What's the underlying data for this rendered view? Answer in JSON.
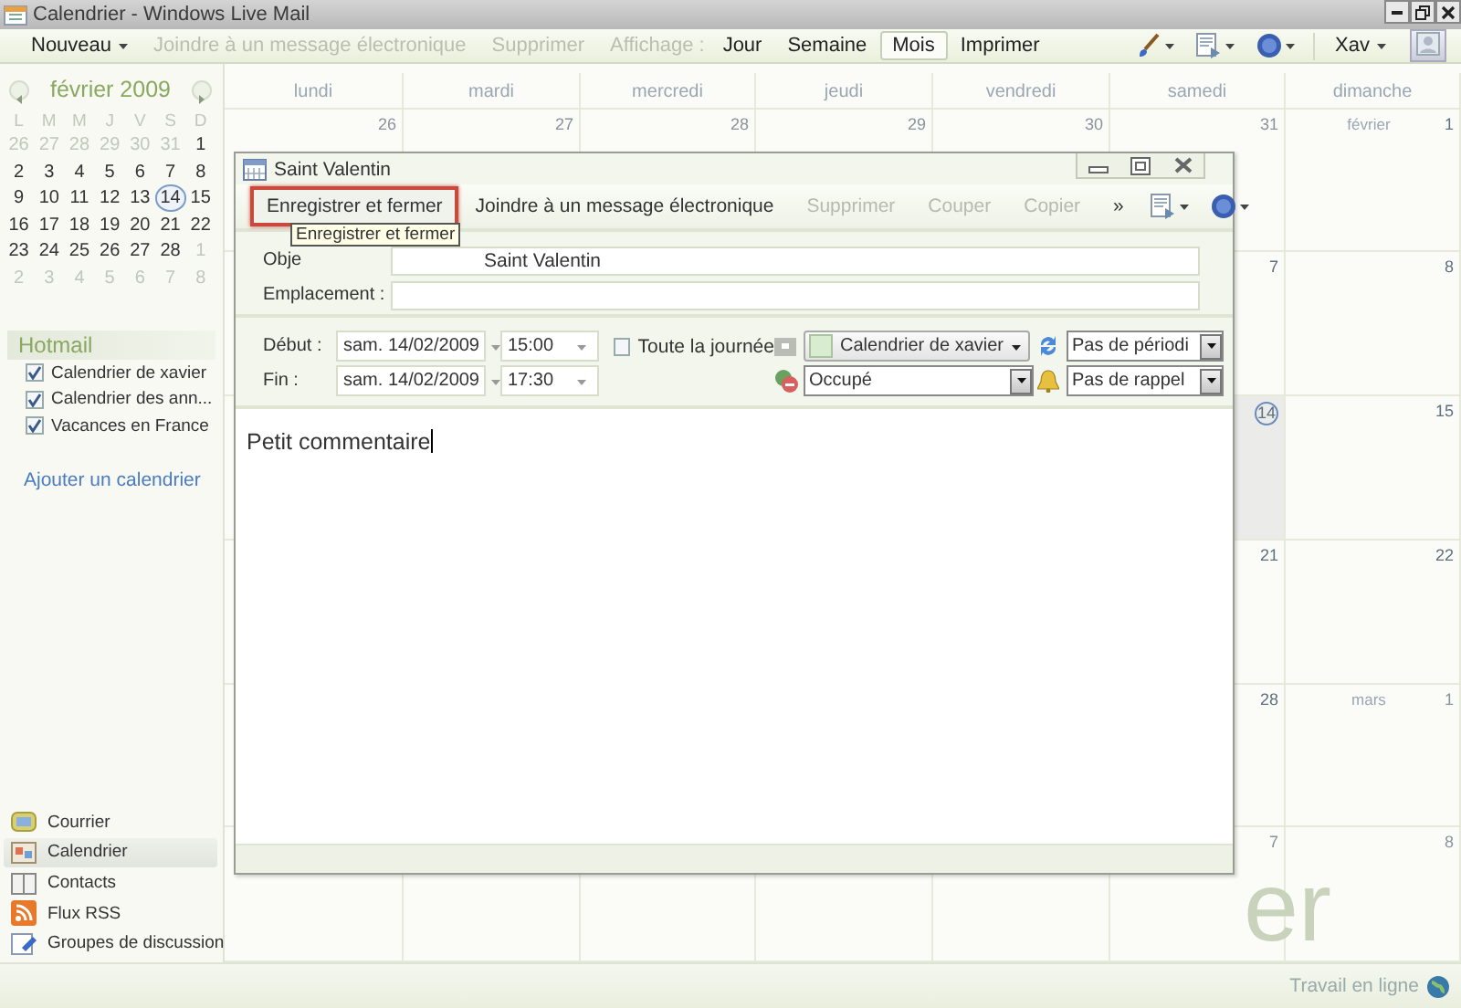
{
  "window": {
    "title": "Calendrier - Windows Live Mail"
  },
  "toolbar": [
    {
      "label": "Nouveau",
      "kind": "menu",
      "disabled": false,
      "selected": false
    },
    {
      "label": "Joindre à un message électronique",
      "kind": "button",
      "disabled": true,
      "selected": false
    },
    {
      "label": "Supprimer",
      "kind": "button",
      "disabled": true,
      "selected": false
    },
    {
      "label": "Affichage :",
      "kind": "label",
      "disabled": true,
      "selected": false
    },
    {
      "label": "Jour",
      "kind": "button",
      "disabled": false,
      "selected": false
    },
    {
      "label": "Semaine",
      "kind": "button",
      "disabled": false,
      "selected": false
    },
    {
      "label": "Mois",
      "kind": "button",
      "disabled": false,
      "selected": true
    },
    {
      "label": "Imprimer",
      "kind": "button",
      "disabled": false,
      "selected": false
    }
  ],
  "user_menu": {
    "label": "Xav"
  },
  "mini_calendar": {
    "month": "février 2009",
    "weekdays": [
      "L",
      "M",
      "M",
      "J",
      "V",
      "S",
      "D"
    ],
    "weeks": [
      [
        {
          "day": "26",
          "other": true,
          "today": false
        },
        {
          "day": "27",
          "other": true,
          "today": false
        },
        {
          "day": "28",
          "other": true,
          "today": false
        },
        {
          "day": "29",
          "other": true,
          "today": false
        },
        {
          "day": "30",
          "other": true,
          "today": false
        },
        {
          "day": "31",
          "other": true,
          "today": false
        },
        {
          "day": "1",
          "other": false,
          "today": false
        }
      ],
      [
        {
          "day": "2",
          "other": false,
          "today": false
        },
        {
          "day": "3",
          "other": false,
          "today": false
        },
        {
          "day": "4",
          "other": false,
          "today": false
        },
        {
          "day": "5",
          "other": false,
          "today": false
        },
        {
          "day": "6",
          "other": false,
          "today": false
        },
        {
          "day": "7",
          "other": false,
          "today": false
        },
        {
          "day": "8",
          "other": false,
          "today": false
        }
      ],
      [
        {
          "day": "9",
          "other": false,
          "today": false
        },
        {
          "day": "10",
          "other": false,
          "today": false
        },
        {
          "day": "11",
          "other": false,
          "today": false
        },
        {
          "day": "12",
          "other": false,
          "today": false
        },
        {
          "day": "13",
          "other": false,
          "today": false
        },
        {
          "day": "14",
          "other": false,
          "today": true
        },
        {
          "day": "15",
          "other": false,
          "today": false
        }
      ],
      [
        {
          "day": "16",
          "other": false,
          "today": false
        },
        {
          "day": "17",
          "other": false,
          "today": false
        },
        {
          "day": "18",
          "other": false,
          "today": false
        },
        {
          "day": "19",
          "other": false,
          "today": false
        },
        {
          "day": "20",
          "other": false,
          "today": false
        },
        {
          "day": "21",
          "other": false,
          "today": false
        },
        {
          "day": "22",
          "other": false,
          "today": false
        }
      ],
      [
        {
          "day": "23",
          "other": false,
          "today": false
        },
        {
          "day": "24",
          "other": false,
          "today": false
        },
        {
          "day": "25",
          "other": false,
          "today": false
        },
        {
          "day": "26",
          "other": false,
          "today": false
        },
        {
          "day": "27",
          "other": false,
          "today": false
        },
        {
          "day": "28",
          "other": false,
          "today": false
        },
        {
          "day": "1",
          "other": true,
          "today": false
        }
      ],
      [
        {
          "day": "2",
          "other": true,
          "today": false
        },
        {
          "day": "3",
          "other": true,
          "today": false
        },
        {
          "day": "4",
          "other": true,
          "today": false
        },
        {
          "day": "5",
          "other": true,
          "today": false
        },
        {
          "day": "6",
          "other": true,
          "today": false
        },
        {
          "day": "7",
          "other": true,
          "today": false
        },
        {
          "day": "8",
          "other": true,
          "today": false
        }
      ]
    ]
  },
  "calendars": {
    "header": "Hotmail",
    "items": [
      {
        "label": "Calendrier de xavier",
        "checked": true
      },
      {
        "label": "Calendrier des ann...",
        "checked": true
      },
      {
        "label": "Vacances en France",
        "checked": true
      }
    ],
    "add_link": "Ajouter un calendrier"
  },
  "nav": [
    {
      "label": "Courrier",
      "kind": "mail",
      "selected": false
    },
    {
      "label": "Calendrier",
      "kind": "calendar",
      "selected": true
    },
    {
      "label": "Contacts",
      "kind": "contacts",
      "selected": false
    },
    {
      "label": "Flux RSS",
      "kind": "rss",
      "selected": false
    },
    {
      "label": "Groupes de discussion",
      "kind": "newsgroup",
      "selected": false
    }
  ],
  "calendar": {
    "weekdays": [
      "lundi",
      "mardi",
      "mercredi",
      "jeudi",
      "vendredi",
      "samedi",
      "dimanche"
    ],
    "weeks": [
      {
        "cells": [
          {
            "day": "26",
            "other": true,
            "today": false
          },
          {
            "day": "27",
            "other": true,
            "today": false
          },
          {
            "day": "28",
            "other": true,
            "today": false
          },
          {
            "day": "29",
            "other": true,
            "today": false
          },
          {
            "day": "30",
            "other": true,
            "today": false
          },
          {
            "day": "31",
            "other": true,
            "today": false
          },
          {
            "month": "février",
            "day": "1",
            "other": false,
            "today": false
          }
        ]
      },
      {
        "cells": [
          {
            "day": "7",
            "other": false,
            "today": false
          },
          {
            "day": "8",
            "other": false,
            "today": false
          }
        ]
      },
      {
        "cells": [
          {
            "day": "14",
            "other": false,
            "today": true
          },
          {
            "day": "15",
            "other": false,
            "today": false
          }
        ]
      },
      {
        "cells": [
          {
            "day": "21",
            "other": false,
            "today": false
          },
          {
            "day": "22",
            "other": false,
            "today": false
          }
        ]
      },
      {
        "cells": [
          {
            "day": "28",
            "other": false,
            "today": false
          },
          {
            "month": "mars",
            "day": "1",
            "other": true,
            "today": false
          }
        ]
      },
      {
        "cells": [
          {
            "day": "7",
            "other": true,
            "today": false
          },
          {
            "day": "8",
            "other": true,
            "today": false
          }
        ]
      }
    ],
    "watermark": "er"
  },
  "dialog": {
    "title": "Saint Valentin",
    "toolbar": [
      {
        "label": "Enregistrer et fermer",
        "disabled": false,
        "focused": true
      },
      {
        "label": "Joindre à un message électronique",
        "disabled": false,
        "focused": false
      },
      {
        "label": "Supprimer",
        "disabled": true,
        "focused": false
      },
      {
        "label": "Couper",
        "disabled": true,
        "focused": false
      },
      {
        "label": "Copier",
        "disabled": true,
        "focused": false
      },
      {
        "label": "»",
        "disabled": false,
        "focused": false
      }
    ],
    "tooltip": "Enregistrer et fermer",
    "subject": {
      "label": "Obje",
      "value": "Saint Valentin"
    },
    "location": {
      "label": "Emplacement :"
    },
    "start": {
      "label": "Début :",
      "date": "sam. 14/02/2009",
      "time": "15:00"
    },
    "end": {
      "label": "Fin :",
      "date": "sam. 14/02/2009",
      "time": "17:30"
    },
    "all_day": {
      "label": "Toute la journée",
      "checked": false
    },
    "calendar": {
      "value": "Calendrier de xavier"
    },
    "availability": {
      "value": "Occupé"
    },
    "recurrence": {
      "value": "Pas de périodi"
    },
    "reminder": {
      "value": "Pas de rappel"
    },
    "notes": "Petit commentaire"
  },
  "status_bar": {
    "text": "Travail en ligne"
  }
}
